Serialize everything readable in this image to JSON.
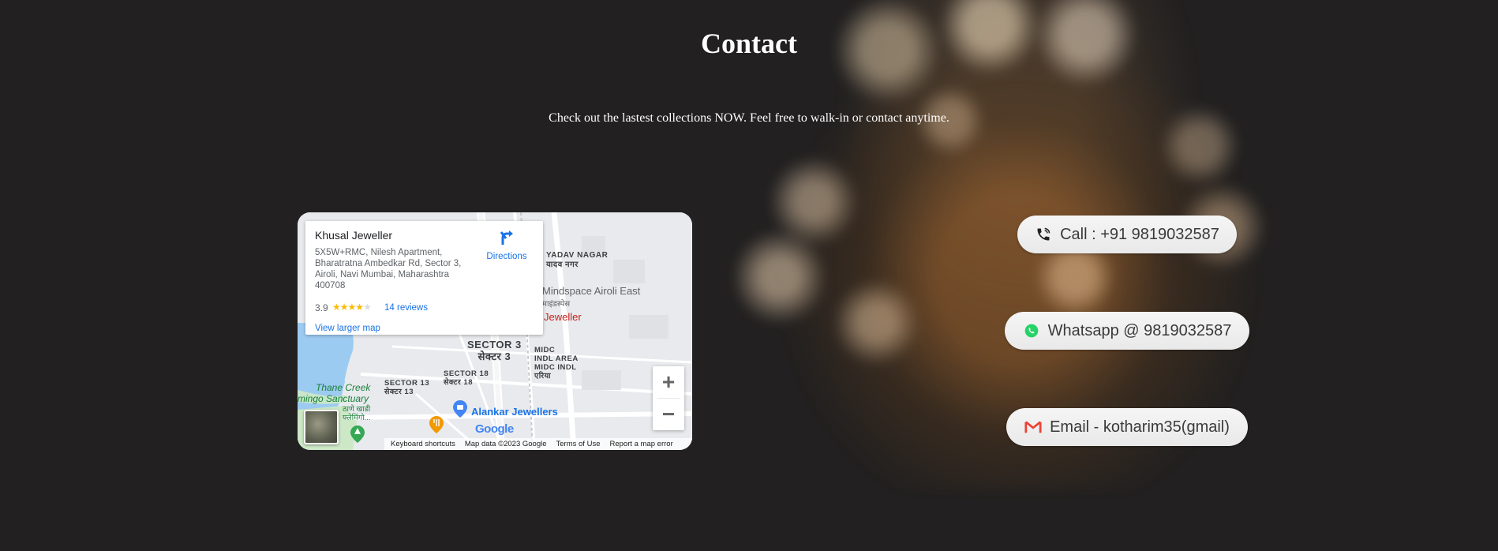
{
  "page": {
    "title": "Contact",
    "subtitle": "Check out the lastest collections NOW. Feel free to walk-in or contact anytime."
  },
  "map": {
    "place_name": "Khusal Jeweller",
    "address": "5X5W+RMC, Nilesh Apartment, Bharatratna Ambedkar Rd, Sector 3, Airoli, Navi Mumbai, Maharashtra 400708",
    "rating": "3.9",
    "rating_stars": 4,
    "reviews_label": "14 reviews",
    "view_larger_label": "View larger map",
    "directions_label": "Directions",
    "labels": {
      "yadav_nagar": "YADAV NAGAR",
      "yadav_nagar_local": "यादव नगर",
      "mindspace": "Mindspace Airoli East",
      "mindspace_local": "माइंडस्पेस",
      "jeweller": "Jeweller",
      "sector3": "SECTOR 3",
      "sector3_local": "सेक्टर 3",
      "midc": "MIDC\nINDL AREA\nMIDC INDL",
      "midc_local": "एरिया",
      "sector18": "SECTOR 18",
      "sector18_local": "सेक्टर 18",
      "sector13": "SECTOR 13",
      "sector13_local": "सेक्टर 13",
      "thane_creek": "Thane Creek",
      "sanctuary": "mingo Sanctuary",
      "sanctuary_local": "ठाणे खाडी\nफ्लेमिंगो...",
      "alankar": "Alankar Jewellers",
      "google": "Google"
    },
    "attribution": {
      "shortcuts": "Keyboard shortcuts",
      "map_data": "Map data ©2023 Google",
      "terms": "Terms of Use",
      "report": "Report a map error"
    }
  },
  "contacts": {
    "call": "Call : +91 9819032587",
    "whatsapp": "Whatsapp @ 9819032587",
    "email": "Email - kotharim35(gmail)"
  },
  "colors": {
    "background": "#222020",
    "pill_bg": "#efefef",
    "whatsapp_green": "#25d366",
    "gmail_red": "#ea4335"
  }
}
